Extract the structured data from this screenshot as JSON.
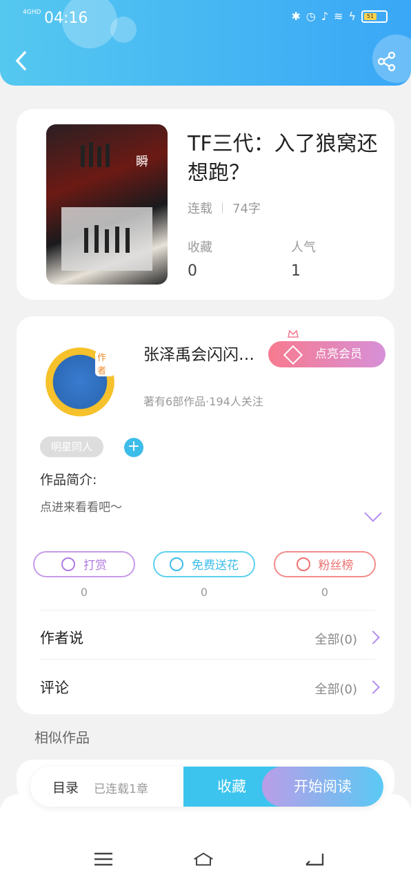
{
  "status": {
    "network": "4GHD",
    "time": "04:16",
    "battery": "51"
  },
  "book": {
    "title": "TF三代：入了狼窝还想跑？",
    "state": "连载",
    "words": "74字",
    "collect_label": "收藏",
    "collect_value": "0",
    "popularity_label": "人气",
    "popularity_value": "1"
  },
  "author": {
    "avatar_tag": "作者",
    "name": "张泽禹会闪闪…",
    "vip_label": "点亮会员",
    "summary": "著有6部作品·194人关注"
  },
  "tags": [
    "明星同人"
  ],
  "intro": {
    "heading": "作品简介:",
    "text": "点进来看看吧～"
  },
  "actions": [
    {
      "label": "打赏",
      "count": "0"
    },
    {
      "label": "免费送花",
      "count": "0"
    },
    {
      "label": "粉丝榜",
      "count": "0"
    }
  ],
  "rows": {
    "author_says": {
      "label": "作者说",
      "value": "全部(0)"
    },
    "comments": {
      "label": "评论",
      "value": "全部(0)"
    }
  },
  "similar_title": "相似作品",
  "bottom": {
    "catalog_label": "目录",
    "chapters": "已连载1章",
    "collect_button": "收藏",
    "read_button": "开始阅读"
  },
  "colors": {
    "header_start": "#55c8f0",
    "header_end": "#3aa7f6",
    "accent": "#3cc4ee",
    "vip": "#f77a8e"
  },
  "icons": [
    "back-icon",
    "share-icon",
    "bluetooth-icon",
    "alarm-icon",
    "mute-icon",
    "wifi-icon",
    "charge-icon",
    "battery-icon",
    "crown-icon",
    "diamond-icon",
    "plus-icon",
    "yen-icon",
    "flower-icon",
    "user-heart-icon",
    "chevron-right-icon",
    "chevron-down-icon",
    "menu-icon",
    "home-icon",
    "return-icon"
  ]
}
